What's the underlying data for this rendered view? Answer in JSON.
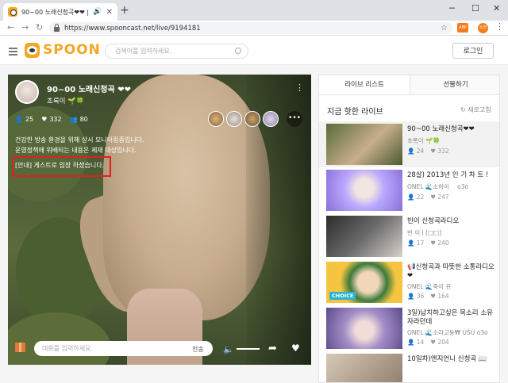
{
  "browser": {
    "tab_title": "90~00 노래신청곡❤❤ | S",
    "new_tab": "+",
    "url": "https://www.spooncast.net/live/9194181",
    "ext_label": "ABP",
    "profile_label": "소연",
    "win_min": "─",
    "win_max": "☐",
    "win_close": "✕"
  },
  "header": {
    "logo": "SPOON",
    "search_placeholder": "검색어를 입력하세요.",
    "login_label": "로그인"
  },
  "live": {
    "title": "90~00 노래신청곡 ❤❤",
    "host": "초록이 🌱🍀",
    "stats": {
      "listeners": "25",
      "likes": "332",
      "fans": "80"
    },
    "notice_lines": [
      "건강한 방송 환경을 위해 상시 모니터링중입니다.",
      "운영정책에 위배되는 내용은 제재 대상입니다."
    ],
    "guest_message": "[안내] 게스트로 입장 하셨습니다.",
    "chat_placeholder": "대화를 입력하세요.",
    "send_label": "전송",
    "more_label": "•••"
  },
  "sidebar": {
    "tabs": [
      "라이브 리스트",
      "선물하기"
    ],
    "heading": "지금 핫한 라이브",
    "refresh": "↻ 새로고침",
    "items": [
      {
        "title": "90~00 노래신청곡❤❤",
        "author": "초록이 🌱🍀",
        "listeners": "24",
        "likes": "332"
      },
      {
        "title": "28살) 2013년 인 기 차 트 !",
        "author": "ONEL 🌊소하이 ⠀ o3o",
        "listeners": "22",
        "likes": "247"
      },
      {
        "title": "빈이 신청곡라디오",
        "author": "빈 이ㅣ[□□]",
        "listeners": "17",
        "likes": "240"
      },
      {
        "title": "📢신청곡과 따뜻한 소통라디오❤",
        "author": "ONEL 🌊죽이 뀨",
        "listeners": "36",
        "likes": "164",
        "tag": "CHOICE"
      },
      {
        "title": "3일)납치하고싶은 목소리 소유자라던데",
        "author": "ONEL 🌊소라고둥₩ ÚŠÙ o3o",
        "listeners": "14",
        "likes": "204"
      },
      {
        "title": "10일차)엔지언니 신청곡 📖",
        "author": "",
        "listeners": "",
        "likes": ""
      }
    ]
  }
}
